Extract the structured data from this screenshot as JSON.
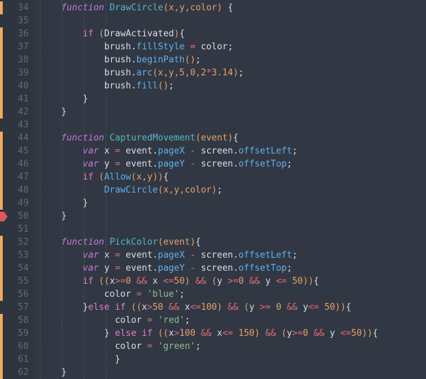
{
  "editor": {
    "name": "code-editor",
    "language": "JavaScript",
    "theme": {
      "background": "#313843",
      "gutter_background": "#2e353f",
      "line_number": "#5f6b7c",
      "text": "#d8dee9",
      "keyword": "#c678dd",
      "control": "#e57ecb",
      "function_name": "#56b6c2",
      "call": "#61afef",
      "parameter": "#e5a06a",
      "number": "#e5a06a",
      "string": "#8fbc8f",
      "operator": "#e06c75",
      "vcs_change_marker": "#f5a956",
      "breakpoint_marker": "#e0565b",
      "indent_guide": "#4b545f"
    },
    "first_visible_line": 34,
    "last_visible_line": 62,
    "line_height": 19,
    "indent_guide_columns": [
      58,
      90,
      122,
      154
    ],
    "gutter_markers": {
      "changed_line_ranges": [
        [
          34,
          34
        ],
        [
          36,
          42
        ],
        [
          44,
          49
        ],
        [
          52,
          55
        ],
        [
          56,
          56
        ],
        [
          58,
          62
        ]
      ],
      "breakpoint_lines": [
        50
      ]
    },
    "lines": [
      {
        "n": 34,
        "indent": 4,
        "text": "function DrawCircle(x,y,color) {"
      },
      {
        "n": 35,
        "indent": 0,
        "text": ""
      },
      {
        "n": 36,
        "indent": 8,
        "text": "if (DrawActivated){"
      },
      {
        "n": 37,
        "indent": 12,
        "text": "brush.fillStyle = color;"
      },
      {
        "n": 38,
        "indent": 12,
        "text": "brush.beginPath();"
      },
      {
        "n": 39,
        "indent": 12,
        "text": "brush.arc(x,y,5,0,2*3.14);"
      },
      {
        "n": 40,
        "indent": 12,
        "text": "brush.fill();"
      },
      {
        "n": 41,
        "indent": 8,
        "text": "}"
      },
      {
        "n": 42,
        "indent": 4,
        "text": "}"
      },
      {
        "n": 43,
        "indent": 0,
        "text": ""
      },
      {
        "n": 44,
        "indent": 4,
        "text": "function CapturedMovement(event){"
      },
      {
        "n": 45,
        "indent": 8,
        "text": "var x = event.pageX - screen.offsetLeft;"
      },
      {
        "n": 46,
        "indent": 8,
        "text": "var y = event.pageY - screen.offsetTop;"
      },
      {
        "n": 47,
        "indent": 8,
        "text": "if (Allow(x,y)){"
      },
      {
        "n": 48,
        "indent": 12,
        "text": "DrawCircle(x,y,color);"
      },
      {
        "n": 49,
        "indent": 8,
        "text": "}"
      },
      {
        "n": 50,
        "indent": 4,
        "text": "}"
      },
      {
        "n": 51,
        "indent": 0,
        "text": ""
      },
      {
        "n": 52,
        "indent": 4,
        "text": "function PickColor(event){"
      },
      {
        "n": 53,
        "indent": 8,
        "text": "var x = event.pageX - screen.offsetLeft;"
      },
      {
        "n": 54,
        "indent": 8,
        "text": "var y = event.pageY - screen.offsetTop;"
      },
      {
        "n": 55,
        "indent": 8,
        "text": "if ((x>=0 && x <=50) && (y >=0 && y <= 50)){"
      },
      {
        "n": 56,
        "indent": 12,
        "text": "color = 'blue';"
      },
      {
        "n": 57,
        "indent": 8,
        "text": "}else if ((x>50 && x<=100) && (y >= 0 && y<= 50)){"
      },
      {
        "n": 58,
        "indent": 14,
        "text": "color = 'red';"
      },
      {
        "n": 59,
        "indent": 12,
        "text": "} else if ((x>100 && x<= 150) && (y>=0 && y <=50)){"
      },
      {
        "n": 60,
        "indent": 14,
        "text": "color = 'green';"
      },
      {
        "n": 61,
        "indent": 14,
        "text": "}"
      },
      {
        "n": 62,
        "indent": 4,
        "text": "}"
      }
    ],
    "tokens": {
      "34": [
        [
          "kw",
          "function"
        ],
        [
          "sp",
          " "
        ],
        [
          "fn",
          "DrawCircle"
        ],
        [
          "punc",
          "("
        ],
        [
          "param",
          "x"
        ],
        [
          "punc",
          ","
        ],
        [
          "param",
          "y"
        ],
        [
          "punc",
          ","
        ],
        [
          "param",
          "color"
        ],
        [
          "punc",
          ")"
        ],
        [
          "sp",
          " "
        ],
        [
          "plain",
          "{"
        ]
      ],
      "36": [
        [
          "ctl",
          "if"
        ],
        [
          "sp",
          " "
        ],
        [
          "punc",
          "("
        ],
        [
          "plain",
          "DrawActivated"
        ],
        [
          "punc",
          ")"
        ],
        [
          "plain",
          "{"
        ]
      ],
      "37": [
        [
          "plain",
          "brush"
        ],
        [
          "plain",
          "."
        ],
        [
          "prop",
          "fillStyle"
        ],
        [
          "sp",
          " "
        ],
        [
          "op",
          "="
        ],
        [
          "sp",
          " "
        ],
        [
          "plain",
          "color"
        ],
        [
          "plain",
          ";"
        ]
      ],
      "38": [
        [
          "plain",
          "brush"
        ],
        [
          "plain",
          "."
        ],
        [
          "call",
          "beginPath"
        ],
        [
          "punc",
          "("
        ],
        [
          "punc",
          ")"
        ],
        [
          "plain",
          ";"
        ]
      ],
      "39": [
        [
          "plain",
          "brush"
        ],
        [
          "plain",
          "."
        ],
        [
          "call",
          "arc"
        ],
        [
          "punc",
          "("
        ],
        [
          "param",
          "x"
        ],
        [
          "punc",
          ","
        ],
        [
          "param",
          "y"
        ],
        [
          "punc",
          ","
        ],
        [
          "num",
          "5"
        ],
        [
          "punc",
          ","
        ],
        [
          "num",
          "0"
        ],
        [
          "punc",
          ","
        ],
        [
          "num",
          "2"
        ],
        [
          "op",
          "*"
        ],
        [
          "num",
          "3.14"
        ],
        [
          "punc",
          ")"
        ],
        [
          "plain",
          ";"
        ]
      ],
      "40": [
        [
          "plain",
          "brush"
        ],
        [
          "plain",
          "."
        ],
        [
          "call",
          "fill"
        ],
        [
          "punc",
          "("
        ],
        [
          "punc",
          ")"
        ],
        [
          "plain",
          ";"
        ]
      ],
      "41": [
        [
          "plain",
          "}"
        ]
      ],
      "42": [
        [
          "plain",
          "}"
        ]
      ],
      "44": [
        [
          "kw",
          "function"
        ],
        [
          "sp",
          " "
        ],
        [
          "fn",
          "CapturedMovement"
        ],
        [
          "punc",
          "("
        ],
        [
          "param",
          "event"
        ],
        [
          "punc",
          ")"
        ],
        [
          "plain",
          "{"
        ]
      ],
      "45": [
        [
          "kw",
          "var"
        ],
        [
          "sp",
          " "
        ],
        [
          "plain",
          "x"
        ],
        [
          "sp",
          " "
        ],
        [
          "op",
          "="
        ],
        [
          "sp",
          " "
        ],
        [
          "plain",
          "event"
        ],
        [
          "plain",
          "."
        ],
        [
          "prop",
          "pageX"
        ],
        [
          "sp",
          " "
        ],
        [
          "op",
          "-"
        ],
        [
          "sp",
          " "
        ],
        [
          "plain",
          "screen"
        ],
        [
          "plain",
          "."
        ],
        [
          "prop",
          "offsetLeft"
        ],
        [
          "plain",
          ";"
        ]
      ],
      "46": [
        [
          "kw",
          "var"
        ],
        [
          "sp",
          " "
        ],
        [
          "plain",
          "y"
        ],
        [
          "sp",
          " "
        ],
        [
          "op",
          "="
        ],
        [
          "sp",
          " "
        ],
        [
          "plain",
          "event"
        ],
        [
          "plain",
          "."
        ],
        [
          "prop",
          "pageY"
        ],
        [
          "sp",
          " "
        ],
        [
          "op",
          "-"
        ],
        [
          "sp",
          " "
        ],
        [
          "plain",
          "screen"
        ],
        [
          "plain",
          "."
        ],
        [
          "prop",
          "offsetTop"
        ],
        [
          "plain",
          ";"
        ]
      ],
      "47": [
        [
          "ctl",
          "if"
        ],
        [
          "sp",
          " "
        ],
        [
          "punc",
          "("
        ],
        [
          "call",
          "Allow"
        ],
        [
          "punc",
          "("
        ],
        [
          "param",
          "x"
        ],
        [
          "punc",
          ","
        ],
        [
          "param",
          "y"
        ],
        [
          "punc",
          ")"
        ],
        [
          "punc",
          ")"
        ],
        [
          "plain",
          "{"
        ]
      ],
      "48": [
        [
          "call",
          "DrawCircle"
        ],
        [
          "punc",
          "("
        ],
        [
          "param",
          "x"
        ],
        [
          "punc",
          ","
        ],
        [
          "param",
          "y"
        ],
        [
          "punc",
          ","
        ],
        [
          "param",
          "color"
        ],
        [
          "punc",
          ")"
        ],
        [
          "plain",
          ";"
        ]
      ],
      "49": [
        [
          "plain",
          "}"
        ]
      ],
      "50": [
        [
          "plain",
          "}"
        ]
      ],
      "52": [
        [
          "kw",
          "function"
        ],
        [
          "sp",
          " "
        ],
        [
          "fn",
          "PickColor"
        ],
        [
          "punc",
          "("
        ],
        [
          "param",
          "event"
        ],
        [
          "punc",
          ")"
        ],
        [
          "plain",
          "{"
        ]
      ],
      "53": [
        [
          "kw",
          "var"
        ],
        [
          "sp",
          " "
        ],
        [
          "plain",
          "x"
        ],
        [
          "sp",
          " "
        ],
        [
          "op",
          "="
        ],
        [
          "sp",
          " "
        ],
        [
          "plain",
          "event"
        ],
        [
          "plain",
          "."
        ],
        [
          "prop",
          "pageX"
        ],
        [
          "sp",
          " "
        ],
        [
          "op",
          "-"
        ],
        [
          "sp",
          " "
        ],
        [
          "plain",
          "screen"
        ],
        [
          "plain",
          "."
        ],
        [
          "prop",
          "offsetLeft"
        ],
        [
          "plain",
          ";"
        ]
      ],
      "54": [
        [
          "kw",
          "var"
        ],
        [
          "sp",
          " "
        ],
        [
          "plain",
          "y"
        ],
        [
          "sp",
          " "
        ],
        [
          "op",
          "="
        ],
        [
          "sp",
          " "
        ],
        [
          "plain",
          "event"
        ],
        [
          "plain",
          "."
        ],
        [
          "prop",
          "pageY"
        ],
        [
          "sp",
          " "
        ],
        [
          "op",
          "-"
        ],
        [
          "sp",
          " "
        ],
        [
          "plain",
          "screen"
        ],
        [
          "plain",
          "."
        ],
        [
          "prop",
          "offsetTop"
        ],
        [
          "plain",
          ";"
        ]
      ],
      "55": [
        [
          "ctl",
          "if"
        ],
        [
          "sp",
          " "
        ],
        [
          "punc",
          "(("
        ],
        [
          "plain",
          "x"
        ],
        [
          "op",
          ">="
        ],
        [
          "num",
          "0"
        ],
        [
          "sp",
          " "
        ],
        [
          "op",
          "&&"
        ],
        [
          "sp",
          " "
        ],
        [
          "plain",
          "x"
        ],
        [
          "sp",
          " "
        ],
        [
          "op",
          "<="
        ],
        [
          "num",
          "50"
        ],
        [
          "punc",
          ")"
        ],
        [
          "sp",
          " "
        ],
        [
          "op",
          "&&"
        ],
        [
          "sp",
          " "
        ],
        [
          "punc",
          "("
        ],
        [
          "plain",
          "y"
        ],
        [
          "sp",
          " "
        ],
        [
          "op",
          ">="
        ],
        [
          "num",
          "0"
        ],
        [
          "sp",
          " "
        ],
        [
          "op",
          "&&"
        ],
        [
          "sp",
          " "
        ],
        [
          "plain",
          "y"
        ],
        [
          "sp",
          " "
        ],
        [
          "op",
          "<="
        ],
        [
          "sp",
          " "
        ],
        [
          "num",
          "50"
        ],
        [
          "punc",
          "))"
        ],
        [
          "plain",
          "{"
        ]
      ],
      "56": [
        [
          "plain",
          "color"
        ],
        [
          "sp",
          " "
        ],
        [
          "op",
          "="
        ],
        [
          "sp",
          " "
        ],
        [
          "str",
          "'blue'"
        ],
        [
          "plain",
          ";"
        ]
      ],
      "57": [
        [
          "plain",
          "}"
        ],
        [
          "ctl",
          "else"
        ],
        [
          "sp",
          " "
        ],
        [
          "ctl",
          "if"
        ],
        [
          "sp",
          " "
        ],
        [
          "punc",
          "(("
        ],
        [
          "plain",
          "x"
        ],
        [
          "op",
          ">"
        ],
        [
          "num",
          "50"
        ],
        [
          "sp",
          " "
        ],
        [
          "op",
          "&&"
        ],
        [
          "sp",
          " "
        ],
        [
          "plain",
          "x"
        ],
        [
          "op",
          "<="
        ],
        [
          "num",
          "100"
        ],
        [
          "punc",
          ")"
        ],
        [
          "sp",
          " "
        ],
        [
          "op",
          "&&"
        ],
        [
          "sp",
          " "
        ],
        [
          "punc",
          "("
        ],
        [
          "plain",
          "y"
        ],
        [
          "sp",
          " "
        ],
        [
          "op",
          ">="
        ],
        [
          "sp",
          " "
        ],
        [
          "num",
          "0"
        ],
        [
          "sp",
          " "
        ],
        [
          "op",
          "&&"
        ],
        [
          "sp",
          " "
        ],
        [
          "plain",
          "y"
        ],
        [
          "op",
          "<="
        ],
        [
          "sp",
          " "
        ],
        [
          "num",
          "50"
        ],
        [
          "punc",
          "))"
        ],
        [
          "plain",
          "{"
        ]
      ],
      "58": [
        [
          "plain",
          "color"
        ],
        [
          "sp",
          " "
        ],
        [
          "op",
          "="
        ],
        [
          "sp",
          " "
        ],
        [
          "str",
          "'red'"
        ],
        [
          "plain",
          ";"
        ]
      ],
      "59": [
        [
          "plain",
          "}"
        ],
        [
          "sp",
          " "
        ],
        [
          "ctl",
          "else"
        ],
        [
          "sp",
          " "
        ],
        [
          "ctl",
          "if"
        ],
        [
          "sp",
          " "
        ],
        [
          "punc",
          "(("
        ],
        [
          "plain",
          "x"
        ],
        [
          "op",
          ">"
        ],
        [
          "num",
          "100"
        ],
        [
          "sp",
          " "
        ],
        [
          "op",
          "&&"
        ],
        [
          "sp",
          " "
        ],
        [
          "plain",
          "x"
        ],
        [
          "op",
          "<="
        ],
        [
          "sp",
          " "
        ],
        [
          "num",
          "150"
        ],
        [
          "punc",
          ")"
        ],
        [
          "sp",
          " "
        ],
        [
          "op",
          "&&"
        ],
        [
          "sp",
          " "
        ],
        [
          "punc",
          "("
        ],
        [
          "plain",
          "y"
        ],
        [
          "op",
          ">="
        ],
        [
          "num",
          "0"
        ],
        [
          "sp",
          " "
        ],
        [
          "op",
          "&&"
        ],
        [
          "sp",
          " "
        ],
        [
          "plain",
          "y"
        ],
        [
          "sp",
          " "
        ],
        [
          "op",
          "<="
        ],
        [
          "num",
          "50"
        ],
        [
          "punc",
          "))"
        ],
        [
          "plain",
          "{"
        ]
      ],
      "60": [
        [
          "plain",
          "color"
        ],
        [
          "sp",
          " "
        ],
        [
          "op",
          "="
        ],
        [
          "sp",
          " "
        ],
        [
          "str",
          "'green'"
        ],
        [
          "plain",
          ";"
        ]
      ],
      "61": [
        [
          "plain",
          "}"
        ]
      ],
      "62": [
        [
          "plain",
          "}"
        ]
      ]
    }
  }
}
